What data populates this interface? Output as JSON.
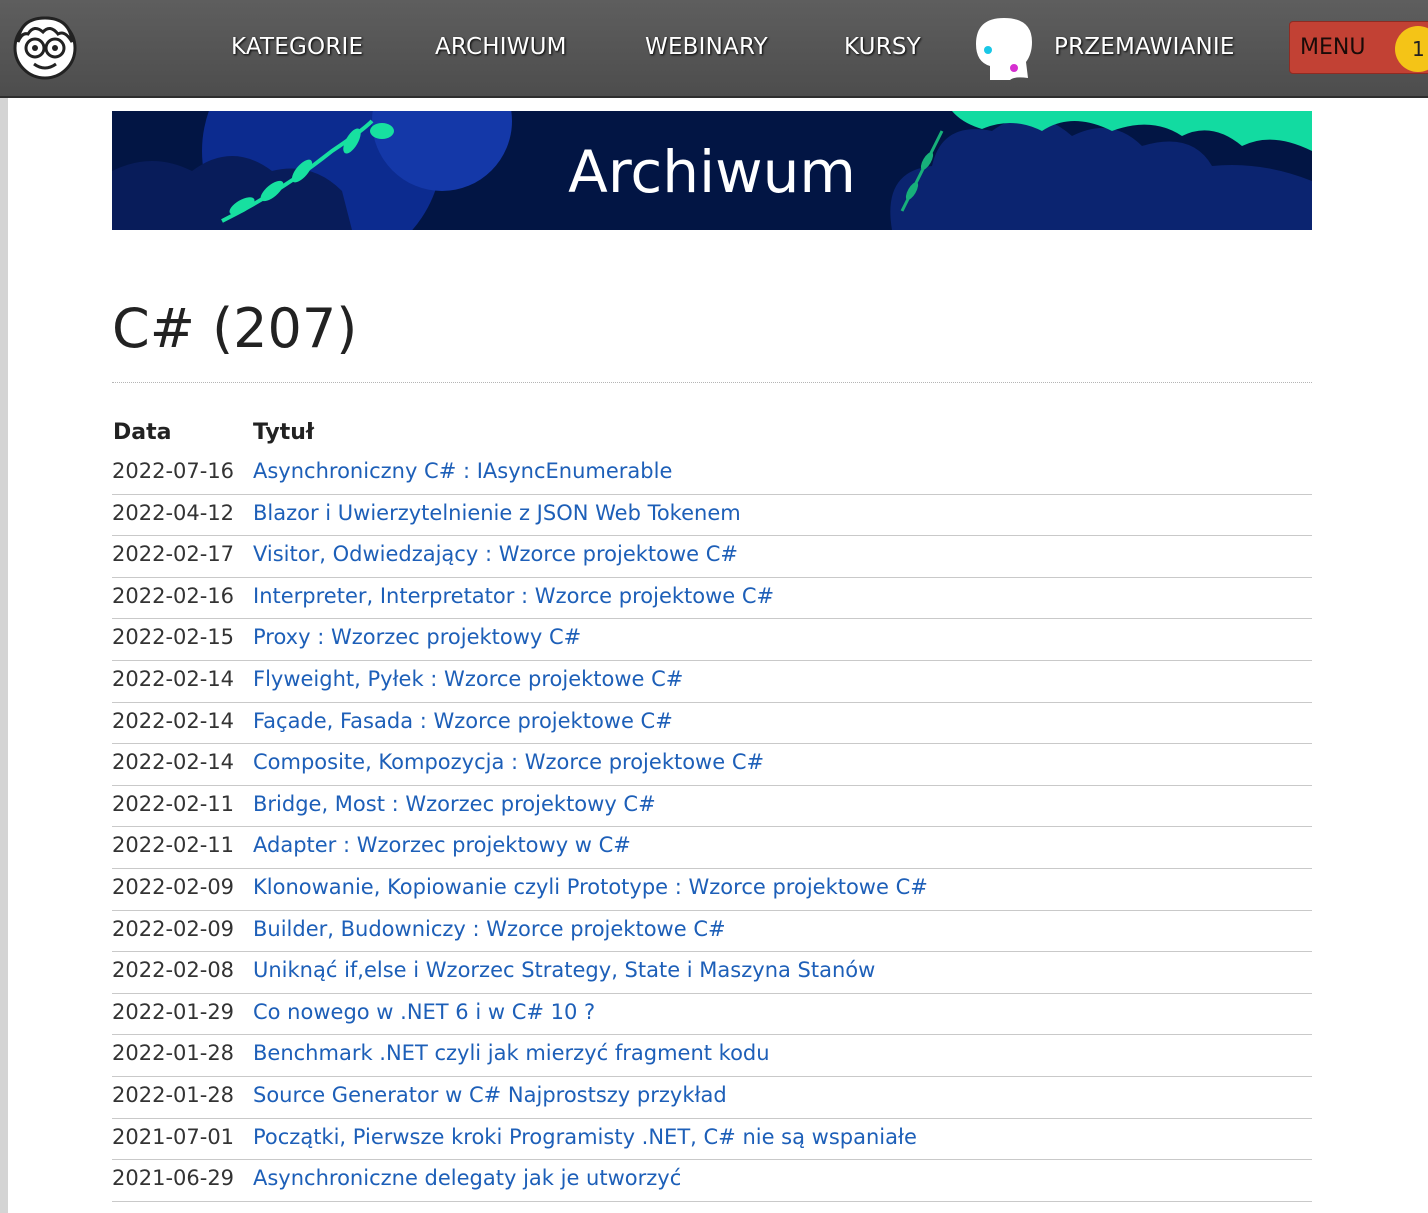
{
  "nav": {
    "items": [
      {
        "label": "KATEGORIE"
      },
      {
        "label": "ARCHIWUM"
      },
      {
        "label": "WEBINARY"
      },
      {
        "label": "KURSY"
      },
      {
        "label": "PRZEMAWIANIE"
      }
    ],
    "menu_label": "MENU",
    "badge_count": "1"
  },
  "banner": {
    "title": "Archiwum"
  },
  "page": {
    "title": "C# (207)"
  },
  "table": {
    "headers": {
      "date": "Data",
      "title": "Tytuł"
    },
    "rows": [
      {
        "date": "2022-07-16",
        "title": "Asynchroniczny C# : IAsyncEnumerable"
      },
      {
        "date": "2022-04-12",
        "title": "Blazor i Uwierzytelnienie z JSON Web Tokenem"
      },
      {
        "date": "2022-02-17",
        "title": "Visitor, Odwiedzający : Wzorce projektowe C#"
      },
      {
        "date": "2022-02-16",
        "title": "Interpreter, Interpretator : Wzorce projektowe C#"
      },
      {
        "date": "2022-02-15",
        "title": "Proxy : Wzorzec projektowy C#"
      },
      {
        "date": "2022-02-14",
        "title": "Flyweight, Pyłek : Wzorce projektowe C#"
      },
      {
        "date": "2022-02-14",
        "title": "Façade, Fasada : Wzorce projektowe C#"
      },
      {
        "date": "2022-02-14",
        "title": "Composite, Kompozycja : Wzorce projektowe C#"
      },
      {
        "date": "2022-02-11",
        "title": "Bridge, Most : Wzorzec projektowy C#"
      },
      {
        "date": "2022-02-11",
        "title": "Adapter : Wzorzec projektowy w C#"
      },
      {
        "date": "2022-02-09",
        "title": "Klonowanie, Kopiowanie czyli Prototype : Wzorce projektowe C#"
      },
      {
        "date": "2022-02-09",
        "title": "Builder, Budowniczy : Wzorce projektowe C#"
      },
      {
        "date": "2022-02-08",
        "title": "Uniknąć if,else i Wzorzec Strategy, State i Maszyna Stanów"
      },
      {
        "date": "2022-01-29",
        "title": "Co nowego w .NET 6 i w C# 10 ?"
      },
      {
        "date": "2022-01-28",
        "title": "Benchmark .NET czyli jak mierzyć fragment kodu"
      },
      {
        "date": "2022-01-28",
        "title": "Source Generator w C# Najprostszy przykład"
      },
      {
        "date": "2021-07-01",
        "title": "Początki, Pierwsze kroki Programisty .NET, C# nie są wspaniałe"
      },
      {
        "date": "2021-06-29",
        "title": "Asynchroniczne delegaty jak je utworzyć"
      }
    ]
  },
  "colors": {
    "topbar": "#555555",
    "menu": "#c24134",
    "badge": "#f4c417",
    "link": "#1d5fb8",
    "banner": "#021544"
  }
}
